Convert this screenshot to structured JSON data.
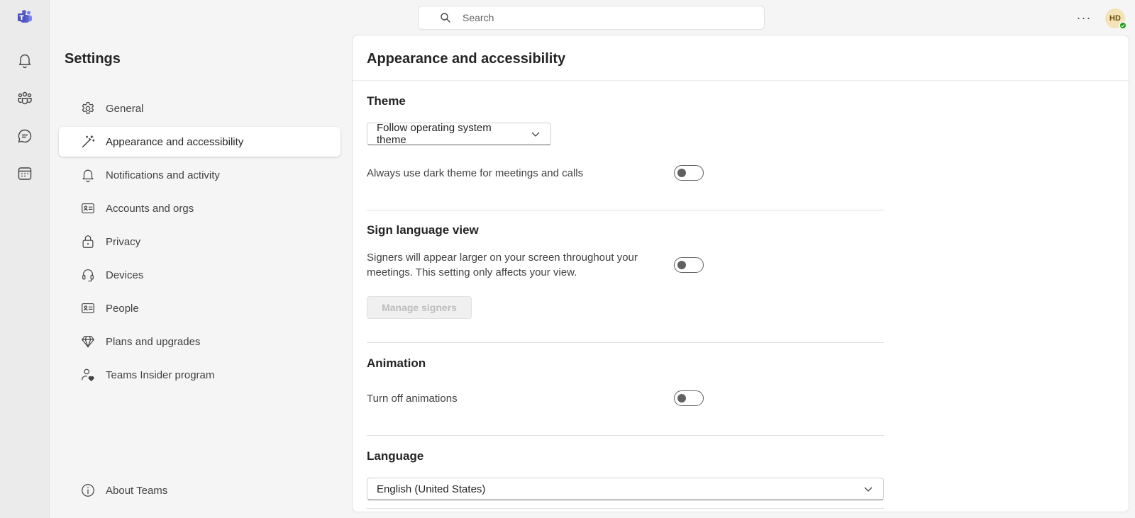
{
  "topbar": {
    "search_placeholder": "Search",
    "more_label": "···",
    "avatar_initials": "HD"
  },
  "rail": {
    "items": [
      {
        "name": "activity",
        "icon": "bell-icon"
      },
      {
        "name": "teams",
        "icon": "people-group-icon"
      },
      {
        "name": "chat",
        "icon": "chat-icon"
      },
      {
        "name": "calendar",
        "icon": "calendar-icon"
      }
    ]
  },
  "settings": {
    "title": "Settings",
    "nav": [
      {
        "label": "General",
        "icon": "gear-icon",
        "active": false
      },
      {
        "label": "Appearance and accessibility",
        "icon": "magic-wand-icon",
        "active": true
      },
      {
        "label": "Notifications and activity",
        "icon": "bell-icon",
        "active": false
      },
      {
        "label": "Accounts and orgs",
        "icon": "contact-card-icon",
        "active": false
      },
      {
        "label": "Privacy",
        "icon": "lock-icon",
        "active": false
      },
      {
        "label": "Devices",
        "icon": "headset-icon",
        "active": false
      },
      {
        "label": "People",
        "icon": "contact-card-icon",
        "active": false
      },
      {
        "label": "Plans and upgrades",
        "icon": "diamond-icon",
        "active": false
      },
      {
        "label": "Teams Insider program",
        "icon": "person-heart-icon",
        "active": false
      }
    ],
    "about": {
      "label": "About Teams",
      "icon": "info-icon"
    }
  },
  "panel": {
    "title": "Appearance and accessibility",
    "theme": {
      "heading": "Theme",
      "dropdown_value": "Follow operating system theme",
      "dark_toggle_label": "Always use dark theme for meetings and calls",
      "dark_toggle_on": false
    },
    "sign_language": {
      "heading": "Sign language view",
      "description_line1": "Signers will appear larger on your screen throughout your",
      "description_line2": "meetings. This setting only affects your view.",
      "toggle_on": false,
      "manage_button": "Manage signers"
    },
    "animation": {
      "heading": "Animation",
      "toggle_label": "Turn off animations",
      "toggle_on": false
    },
    "language": {
      "heading": "Language",
      "dropdown_value": "English (United States)"
    }
  },
  "colors": {
    "teams_purple": "#5b5fc7",
    "presence_green": "#13a10e",
    "avatar_bg": "#f3e3b6"
  }
}
